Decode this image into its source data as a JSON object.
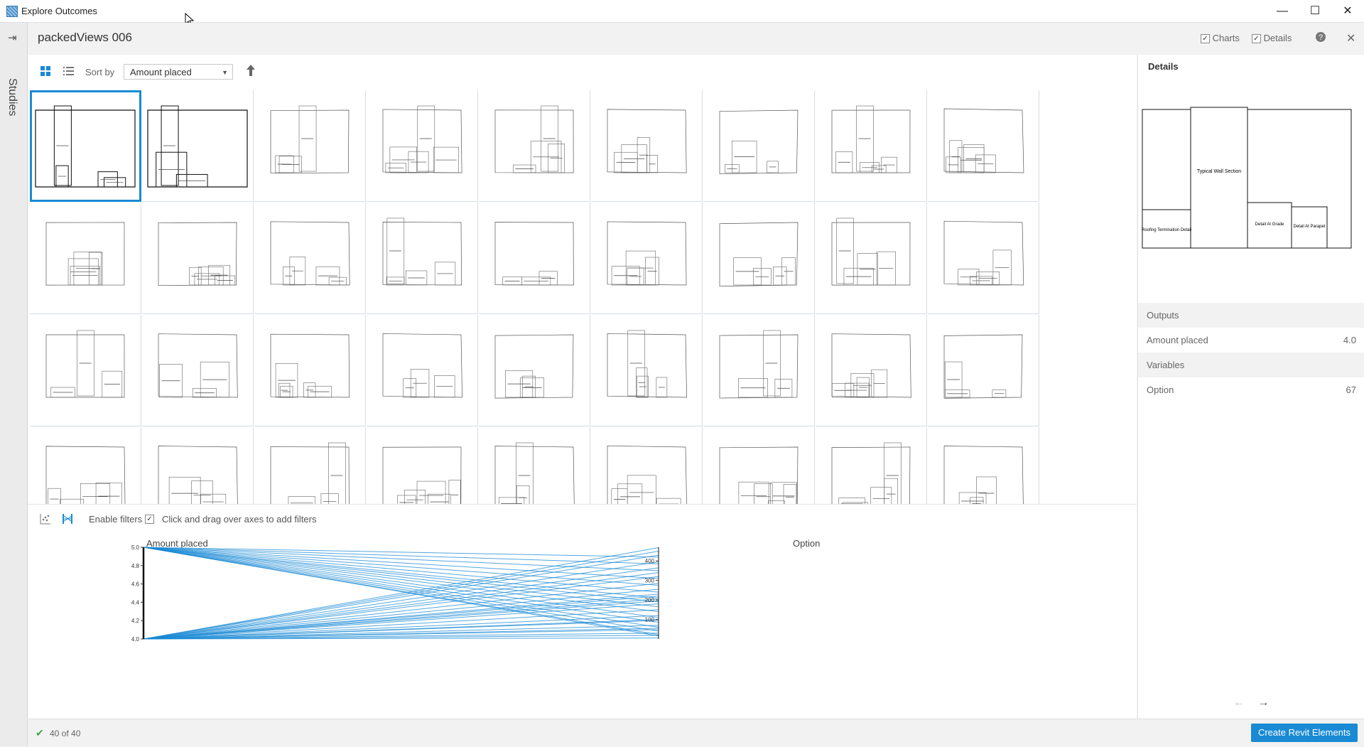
{
  "window": {
    "title": "Explore Outcomes",
    "minimize": "—",
    "maximize": "☐",
    "close": "✕",
    "icon": "app-grid-icon"
  },
  "sidebar": {
    "label": "Studies",
    "collapse_icon": "collapse-panel-icon"
  },
  "header": {
    "study_name": "packedViews 006",
    "charts_label": "Charts",
    "charts_checked": true,
    "details_label": "Details",
    "details_checked": true,
    "help_icon": "help-icon",
    "close_icon": "close-icon"
  },
  "toolbar": {
    "grid_view_icon": "grid-view-icon",
    "list_view_icon": "list-view-icon",
    "sort_label": "Sort by",
    "sort_value": "Amount placed",
    "sort_direction_icon": "sort-ascending-icon"
  },
  "grid": {
    "rows": 5,
    "cols": 9,
    "selected_index": 0,
    "big_labels": [
      "Typical Wall Section",
      "Roofing Termination Detail",
      "Detail At Grade",
      "Detail At Parapet"
    ]
  },
  "filters": {
    "scatter_icon": "scatter-plot-icon",
    "parallel_icon": "parallel-coordinates-icon",
    "enable_label": "Enable filters",
    "enabled": true,
    "hint": "Click and drag over axes to add filters"
  },
  "chart_data": {
    "type": "parallel-coordinates",
    "axes": [
      {
        "name": "Amount placed",
        "range": [
          4.0,
          5.0
        ],
        "ticks": [
          "5.0",
          "4.8",
          "4.6",
          "4.4",
          "4.2",
          "4.0"
        ]
      },
      {
        "name": "Option",
        "range": [
          0,
          470
        ],
        "ticks": [
          "400",
          "300",
          "200",
          "100"
        ]
      }
    ],
    "line_color": "#1a8ad4",
    "lines": [
      [
        5.0,
        15
      ],
      [
        5.0,
        22
      ],
      [
        5.0,
        40
      ],
      [
        5.0,
        60
      ],
      [
        5.0,
        85
      ],
      [
        5.0,
        110
      ],
      [
        5.0,
        140
      ],
      [
        5.0,
        165
      ],
      [
        5.0,
        190
      ],
      [
        5.0,
        210
      ],
      [
        5.0,
        240
      ],
      [
        5.0,
        275
      ],
      [
        5.0,
        310
      ],
      [
        5.0,
        350
      ],
      [
        5.0,
        385
      ],
      [
        5.0,
        420
      ],
      [
        4.0,
        5
      ],
      [
        4.0,
        18
      ],
      [
        4.0,
        30
      ],
      [
        4.0,
        48
      ],
      [
        4.0,
        55
      ],
      [
        4.0,
        70
      ],
      [
        4.0,
        95
      ],
      [
        4.0,
        100
      ],
      [
        4.0,
        120
      ],
      [
        4.0,
        150
      ],
      [
        4.0,
        180
      ],
      [
        4.0,
        195
      ],
      [
        4.0,
        205
      ],
      [
        4.0,
        220
      ],
      [
        4.0,
        230
      ],
      [
        4.0,
        255
      ],
      [
        4.0,
        285
      ],
      [
        4.0,
        320
      ],
      [
        4.0,
        340
      ],
      [
        4.0,
        365
      ],
      [
        4.0,
        395
      ],
      [
        4.0,
        430
      ],
      [
        4.0,
        450
      ],
      [
        4.0,
        468
      ]
    ]
  },
  "details": {
    "title": "Details",
    "preview_labels": {
      "main": "Typical Wall Section",
      "left": "Roofing Termination Detail",
      "mid": "Detail At Grade",
      "right": "Detail At Parapet"
    },
    "outputs_label": "Outputs",
    "outputs": [
      {
        "label": "Amount placed",
        "value": "4.0"
      }
    ],
    "variables_label": "Variables",
    "variables": [
      {
        "label": "Option",
        "value": "67"
      }
    ],
    "prev_icon": "←",
    "next_icon": "→"
  },
  "status": {
    "check_icon": "✔",
    "count": "40 of 40"
  },
  "create_button": "Create Revit Elements"
}
